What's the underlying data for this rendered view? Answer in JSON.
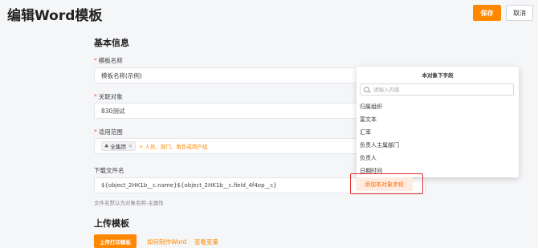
{
  "header": {
    "title": "编辑Word模板",
    "save_label": "保存",
    "cancel_label": "取消"
  },
  "basic_info": {
    "section_title": "基本信息",
    "template_name": {
      "label": "模板名称",
      "value": "模板名称(示例)"
    },
    "related_object": {
      "label": "关联对象",
      "value": "830测试"
    },
    "scope": {
      "label": "适用范围",
      "tag": "全集团",
      "add_text": "+ 人员、部门、角色或用户组"
    },
    "download_name": {
      "label": "下载文件名",
      "value": "${object_2HK1b__c.name}${object_2HK1b__c.field_4f4op__c}",
      "hint": "文件名默认为对象名称-主属性"
    }
  },
  "upload": {
    "section_title": "上传模板",
    "upload_button": "上传打印模板",
    "how_to_link": "如何制作Word",
    "view_vars_link": "查看变量"
  },
  "field_dropdown": {
    "title": "本对象下字段",
    "search_placeholder": "请输入内容",
    "items": [
      "归属组织",
      "富文本",
      "汇率",
      "负责人主属部门",
      "负责人",
      "日期时间"
    ],
    "add_button": "添加本对象字段"
  }
}
